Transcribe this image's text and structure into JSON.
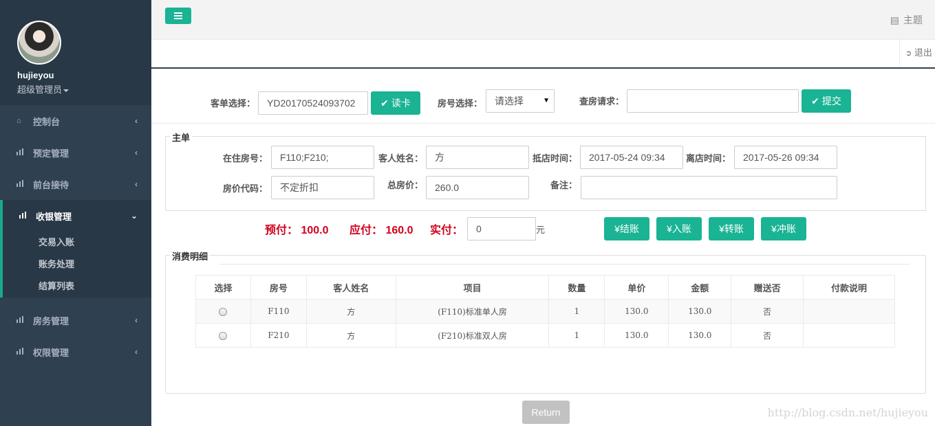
{
  "user": {
    "name": "hujieyou",
    "role": "超级管理员"
  },
  "sidebar": {
    "items": [
      {
        "label": "控制台",
        "icon": "home-icon"
      },
      {
        "label": "预定管理",
        "icon": "bar-chart-icon"
      },
      {
        "label": "前台接待",
        "icon": "bar-chart-icon"
      },
      {
        "label": "收银管理",
        "icon": "bar-chart-icon",
        "expanded": true,
        "children": [
          "交易入账",
          "账务处理",
          "结算列表"
        ]
      },
      {
        "label": "房务管理",
        "icon": "bar-chart-icon"
      },
      {
        "label": "权限管理",
        "icon": "bar-chart-icon"
      }
    ]
  },
  "topbar": {
    "theme_label": "主题",
    "logout_label": "退出"
  },
  "search": {
    "order_label": "客单选择：",
    "order_value": "YD20170524093702",
    "read_card_label": "读卡",
    "room_label": "房号选择：",
    "room_select": "请选择",
    "check_label": "查房请求：",
    "check_value": "",
    "submit_label": "提交"
  },
  "main_order": {
    "legend": "主单",
    "room_no_label": "在住房号：",
    "room_no": "F110;F210;",
    "guest_label": "客人姓名：",
    "guest": "方",
    "arrive_label": "抵店时间：",
    "arrive": "2017-05-24 09:34",
    "leave_label": "离店时间：",
    "leave": "2017-05-26 09:34",
    "rate_code_label": "房价代码：",
    "rate_code": "不定折扣",
    "total_label": "总房价：",
    "total": "260.0",
    "remark_label": "备注：",
    "remark": ""
  },
  "payment": {
    "prepaid_label": "预付：",
    "prepaid": "100.0",
    "due_label": "应付：",
    "due": "160.0",
    "actual_label": "实付：",
    "actual_value": "0",
    "unit": "元",
    "buttons": [
      "¥结账",
      "¥入账",
      "¥转账",
      "¥冲账"
    ]
  },
  "detail": {
    "legend": "消费明细",
    "columns": [
      "选择",
      "房号",
      "客人姓名",
      "项目",
      "数量",
      "单价",
      "金额",
      "赠送否",
      "付款说明"
    ],
    "rows": [
      [
        "F110",
        "方",
        "(F110)标准单人房",
        "1",
        "130.0",
        "130.0",
        "否",
        ""
      ],
      [
        "F210",
        "方",
        "(F210)标准双人房",
        "1",
        "130.0",
        "130.0",
        "否",
        ""
      ]
    ]
  },
  "return_label": "Return",
  "watermark": "http://blog.csdn.net/hujieyou",
  "colors": {
    "accent": "#1ab394",
    "sidebar": "#2f4050",
    "alert": "#d0021b"
  }
}
